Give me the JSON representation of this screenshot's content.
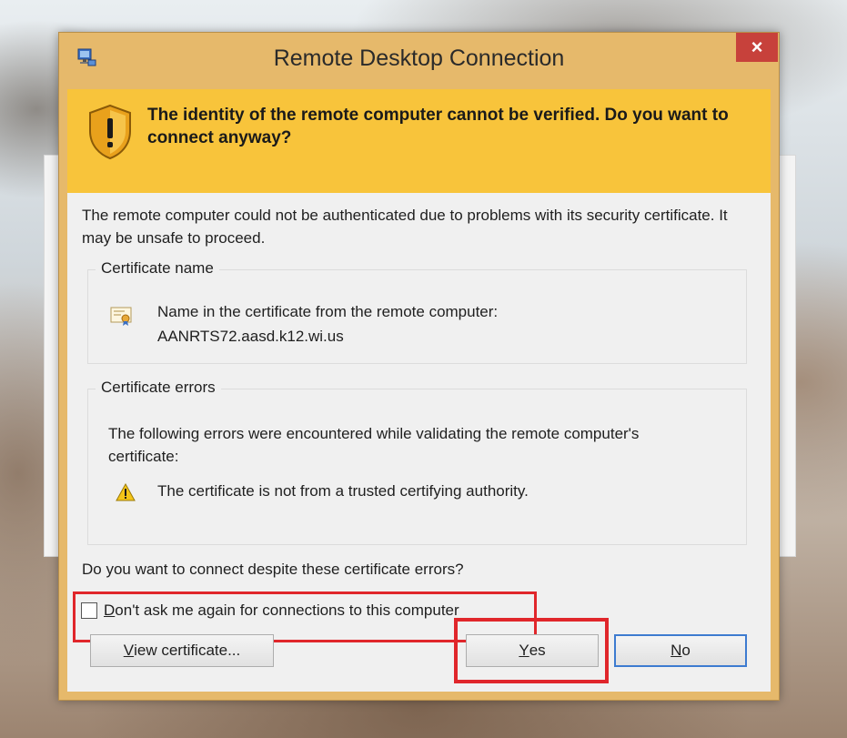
{
  "window": {
    "title": "Remote Desktop Connection",
    "close_label": "×"
  },
  "banner": {
    "message": "The identity of the remote computer cannot be verified. Do you want to connect anyway?"
  },
  "body": {
    "intro": "The remote computer could not be authenticated due to problems with its security certificate. It may be unsafe to proceed.",
    "certificate_name": {
      "legend": "Certificate name",
      "line1": "Name in the certificate from the remote computer:",
      "line2": "AANRTS72.aasd.k12.wi.us"
    },
    "certificate_errors": {
      "legend": "Certificate errors",
      "intro": "The following errors were encountered while validating the remote computer's certificate:",
      "items": [
        "The certificate is not from a trusted certifying authority."
      ]
    },
    "question": "Do you want to connect despite these certificate errors?",
    "dont_ask": {
      "accesskey": "D",
      "rest": "on't ask me again for connections to this computer",
      "checked": false
    }
  },
  "buttons": {
    "view_certificate": {
      "accesskey": "V",
      "rest": "iew certificate..."
    },
    "yes": {
      "accesskey": "Y",
      "rest": "es"
    },
    "no": {
      "accesskey": "N",
      "rest": "o"
    }
  },
  "colors": {
    "banner": "#f8c43b",
    "frame": "#e6b96b",
    "close_button": "#c7413b",
    "highlight": "#e0262b",
    "default_button_border": "#3d7bd0"
  },
  "icons": {
    "app": "remote-desktop-icon",
    "banner": "shield-warning-icon",
    "certificate": "certificate-icon",
    "error": "warning-triangle-icon"
  }
}
